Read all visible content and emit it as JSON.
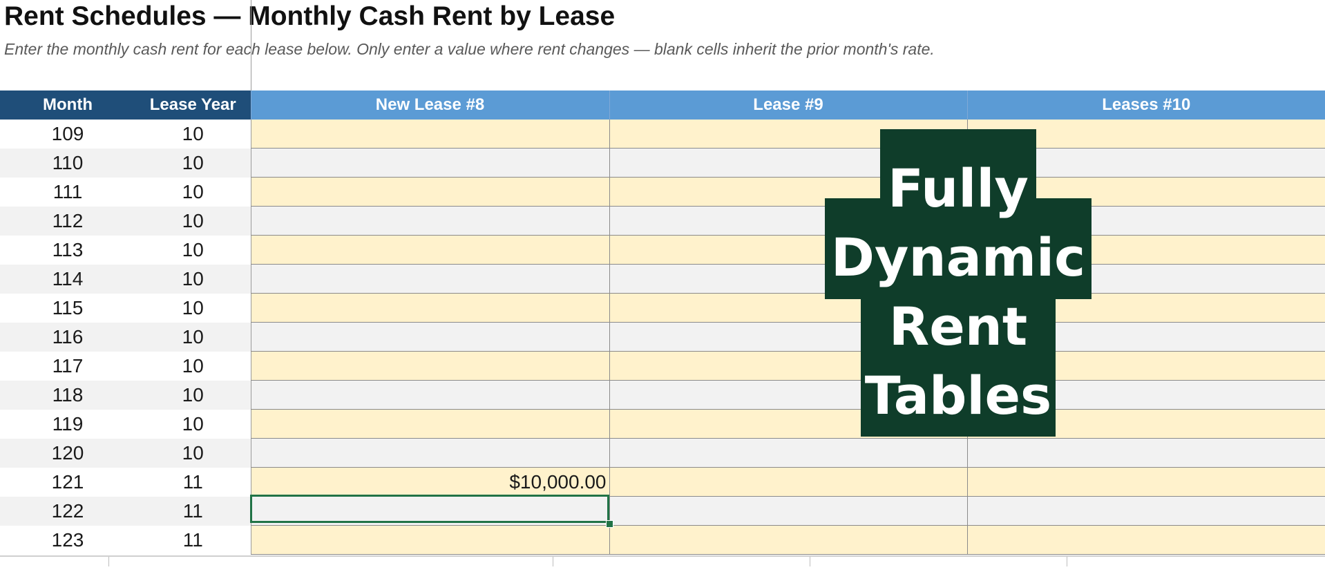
{
  "header": {
    "title": "Rent Schedules — Monthly Cash Rent by Lease",
    "subtitle": "Enter the monthly cash rent for each lease below. Only enter a value where rent changes — blank cells inherit the prior month's rate."
  },
  "table": {
    "columns": [
      "Month",
      "Lease Year",
      "New Lease #8",
      "Lease #9",
      "Leases #10"
    ],
    "rows": [
      {
        "month": "109",
        "lease_year": "10",
        "lease8": "",
        "lease9": "",
        "lease10": ""
      },
      {
        "month": "110",
        "lease_year": "10",
        "lease8": "",
        "lease9": "",
        "lease10": ""
      },
      {
        "month": "111",
        "lease_year": "10",
        "lease8": "",
        "lease9": "",
        "lease10": ""
      },
      {
        "month": "112",
        "lease_year": "10",
        "lease8": "",
        "lease9": "",
        "lease10": ""
      },
      {
        "month": "113",
        "lease_year": "10",
        "lease8": "",
        "lease9": "",
        "lease10": ""
      },
      {
        "month": "114",
        "lease_year": "10",
        "lease8": "",
        "lease9": "",
        "lease10": ""
      },
      {
        "month": "115",
        "lease_year": "10",
        "lease8": "",
        "lease9": "",
        "lease10": ""
      },
      {
        "month": "116",
        "lease_year": "10",
        "lease8": "",
        "lease9": "",
        "lease10": ""
      },
      {
        "month": "117",
        "lease_year": "10",
        "lease8": "",
        "lease9": "",
        "lease10": ""
      },
      {
        "month": "118",
        "lease_year": "10",
        "lease8": "",
        "lease9": "",
        "lease10": ""
      },
      {
        "month": "119",
        "lease_year": "10",
        "lease8": "",
        "lease9": "",
        "lease10": ""
      },
      {
        "month": "120",
        "lease_year": "10",
        "lease8": "",
        "lease9": "",
        "lease10": ""
      },
      {
        "month": "121",
        "lease_year": "11",
        "lease8": "$10,000.00",
        "lease9": "",
        "lease10": ""
      },
      {
        "month": "122",
        "lease_year": "11",
        "lease8": "",
        "lease9": "",
        "lease10": ""
      },
      {
        "month": "123",
        "lease_year": "11",
        "lease8": "",
        "lease9": "",
        "lease10": ""
      }
    ]
  },
  "overlay": {
    "lines": [
      "Fully",
      "Dynamic",
      "Rent",
      "Tables"
    ]
  },
  "colors": {
    "header_dark": "#1f4e79",
    "header_light": "#5b9bd5",
    "input_cell": "#fff2cc",
    "alt_row": "#f2f2f2",
    "selection": "#217346",
    "overlay_bg": "#0f3d2a"
  }
}
